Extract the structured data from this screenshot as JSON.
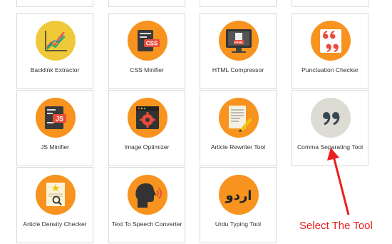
{
  "tools": [
    {
      "label": "Backlink Extractor",
      "icon": "chart-growth-icon",
      "bg": "#f0c93b"
    },
    {
      "label": "CSS Minifier",
      "icon": "css-file-icon",
      "bg": "#f7931e"
    },
    {
      "label": "HTML Compressor",
      "icon": "html-monitor-icon",
      "bg": "#f7931e"
    },
    {
      "label": "Punctuation Checker",
      "icon": "quote-marks-icon",
      "bg": "#f7931e"
    },
    {
      "label": "JS Minifier",
      "icon": "js-file-icon",
      "bg": "#f7931e"
    },
    {
      "label": "Image Optimizer",
      "icon": "gear-window-icon",
      "bg": "#f7931e"
    },
    {
      "label": "Article Rewriter Tool",
      "icon": "document-pencil-icon",
      "bg": "#f7931e"
    },
    {
      "label": "Comma Separating Tool",
      "icon": "comma-quote-icon",
      "bg": "#dcdcd4"
    },
    {
      "label": "Article Density Checker",
      "icon": "document-search-icon",
      "bg": "#f7931e"
    },
    {
      "label": "Text To Speech Converter",
      "icon": "speaking-head-icon",
      "bg": "#f7931e"
    },
    {
      "label": "Urdu Typing Tool",
      "icon": "urdu-text-icon",
      "bg": "#f7931e"
    }
  ],
  "icon_text": {
    "css": "CSS",
    "html": "HTML",
    "js": "JS",
    "urdu": "اردو"
  },
  "annotation": {
    "text": "Select The Tool",
    "color": "#e8201f"
  }
}
